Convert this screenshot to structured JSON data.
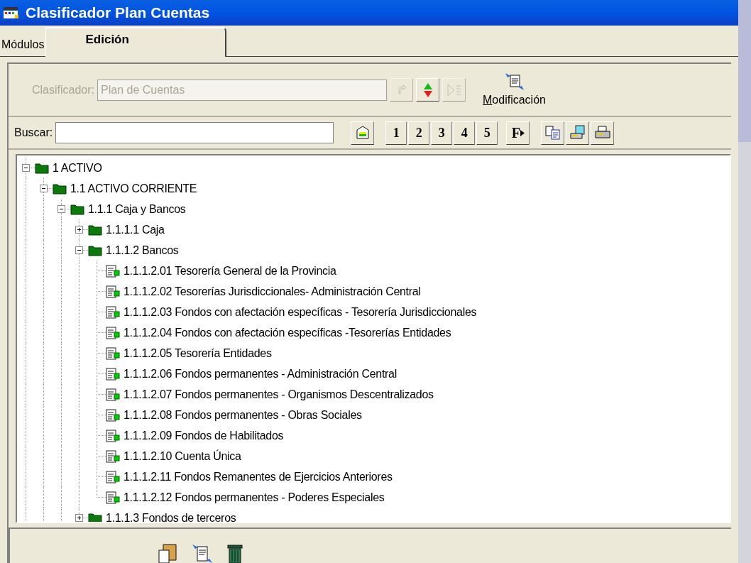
{
  "window": {
    "title": "Clasificador Plan Cuentas"
  },
  "tabs": [
    {
      "label": "Módulos",
      "selected": false
    },
    {
      "label": "Edición",
      "selected": true
    }
  ],
  "clasificador": {
    "label": "Clasificador:",
    "value": "Plan de Cuentas",
    "disabled": true
  },
  "modificacion_button": {
    "label": "Modificación"
  },
  "search": {
    "label": "Buscar:"
  },
  "level_buttons": [
    "1",
    "2",
    "3",
    "4",
    "5"
  ],
  "format_button": "F",
  "tree": [
    {
      "label": "1 ACTIVO",
      "kind": "folder",
      "expanded": true,
      "children": [
        {
          "label": "1.1 ACTIVO CORRIENTE",
          "kind": "folder",
          "expanded": true,
          "children": [
            {
              "label": "1.1.1 Caja y Bancos",
              "kind": "folder",
              "expanded": true,
              "children": [
                {
                  "label": "1.1.1.1 Caja",
                  "kind": "folder",
                  "expanded": false
                },
                {
                  "label": "1.1.1.2 Bancos",
                  "kind": "folder",
                  "expanded": true,
                  "children": [
                    {
                      "label": "1.1.1.2.01 Tesorería General de la Provincia",
                      "kind": "leaf"
                    },
                    {
                      "label": "1.1.1.2.02 Tesorerías Jurisdiccionales- Administración Central",
                      "kind": "leaf"
                    },
                    {
                      "label": "1.1.1.2.03 Fondos con afectación específicas - Tesorería Jurisdiccionales",
                      "kind": "leaf"
                    },
                    {
                      "label": "1.1.1.2.04 Fondos con afectación específicas -Tesorerías Entidades",
                      "kind": "leaf"
                    },
                    {
                      "label": "1.1.1.2.05 Tesorería Entidades",
                      "kind": "leaf"
                    },
                    {
                      "label": "1.1.1.2.06 Fondos permanentes - Administración Central",
                      "kind": "leaf"
                    },
                    {
                      "label": "1.1.1.2.07 Fondos permanentes - Organismos Descentralizados",
                      "kind": "leaf"
                    },
                    {
                      "label": "1.1.1.2.08 Fondos permanentes - Obras Sociales",
                      "kind": "leaf"
                    },
                    {
                      "label": "1.1.1.2.09 Fondos de Habilitados",
                      "kind": "leaf"
                    },
                    {
                      "label": "1.1.1.2.10 Cuenta Única",
                      "kind": "leaf"
                    },
                    {
                      "label": "1.1.1.2.11 Fondos Remanentes de Ejercicios Anteriores",
                      "kind": "leaf"
                    },
                    {
                      "label": "1.1.1.2.12 Fondos permanentes - Poderes Especiales",
                      "kind": "leaf"
                    }
                  ]
                },
                {
                  "label": "1.1.1.3 Fondos de terceros",
                  "kind": "folder",
                  "expanded": false
                }
              ]
            }
          ]
        }
      ]
    }
  ]
}
